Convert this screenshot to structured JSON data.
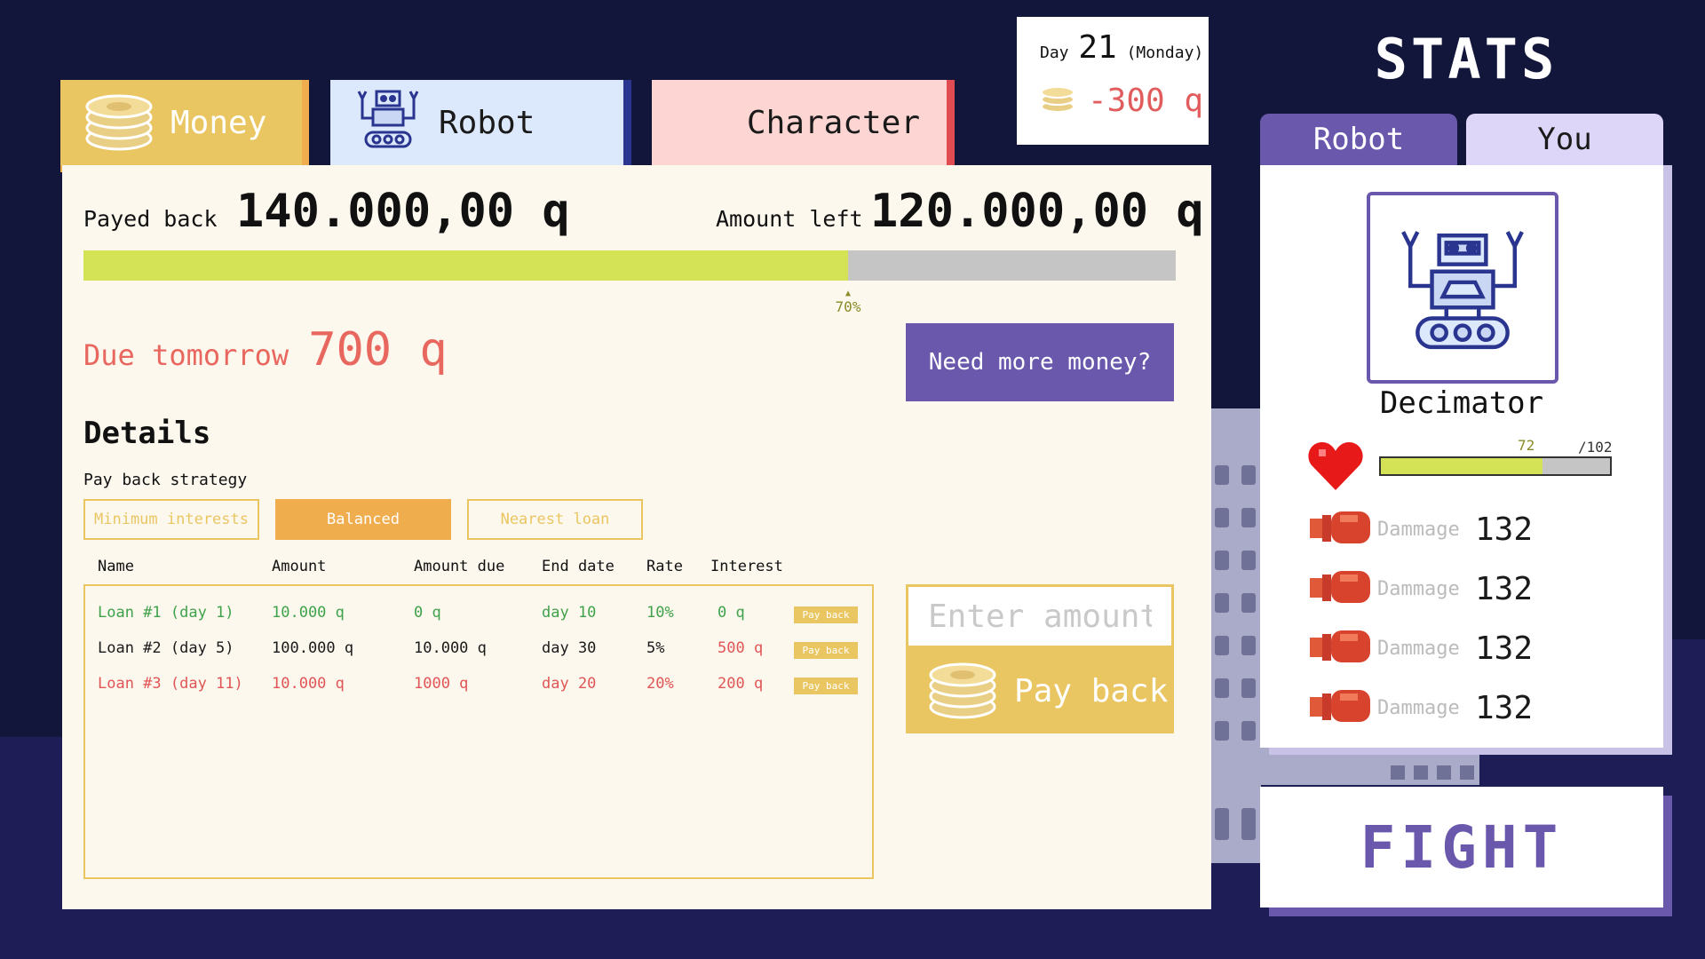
{
  "colors": {
    "background": "#13163b",
    "gold": "#eac662",
    "orange": "#f0ad4e",
    "purple": "#6a58ad",
    "progress_fill": "#d3e355",
    "green": "#3fa24a",
    "red": "#e05555"
  },
  "tabs": [
    {
      "label": "Money",
      "icon": "coins-icon"
    },
    {
      "label": "Robot",
      "icon": "robot-icon"
    },
    {
      "label": "Character"
    }
  ],
  "day": {
    "prefix": "Day",
    "number": "21",
    "weekday": "(Monday)",
    "balance": "-300 q",
    "balance_icon": "coins-icon"
  },
  "money": {
    "payed_back_label": "Payed back",
    "payed_back_value": "140.000,00 q",
    "amount_left_label": "Amount left",
    "amount_left_value": "120.000,00 q",
    "progress_percent": 70,
    "progress_label": "70%",
    "due_label": "Due tomorrow",
    "due_value": "700 q",
    "more_money_button": "Need more money?",
    "details_title": "Details",
    "strategy_label": "Pay back strategy",
    "strategies": [
      {
        "label": "Minimum interests",
        "active": false
      },
      {
        "label": "Balanced",
        "active": true
      },
      {
        "label": "Nearest loan",
        "active": false
      }
    ],
    "columns": [
      "Name",
      "Amount",
      "Amount due",
      "End date",
      "Rate",
      "Interest"
    ],
    "loans": [
      {
        "name": "Loan #1 (day 1)",
        "amount": "10.000 q",
        "amount_due": "0 q",
        "end_date": "day 10",
        "rate": "10%",
        "interest": "0 q",
        "status": "green",
        "action": "Pay back"
      },
      {
        "name": "Loan #2 (day 5)",
        "amount": "100.000 q",
        "amount_due": "10.000 q",
        "end_date": "day 30",
        "rate": "5%",
        "interest": "500 q",
        "status": "black",
        "action": "Pay back"
      },
      {
        "name": "Loan #3 (day 11)",
        "amount": "10.000 q",
        "amount_due": "1000 q",
        "end_date": "day 20",
        "rate": "20%",
        "interest": "200 q",
        "status": "red",
        "action": "Pay back"
      }
    ],
    "amount_input_placeholder": "Enter amount",
    "pay_back_button": "Pay back"
  },
  "stats": {
    "title": "STATS",
    "tabs": [
      {
        "label": "Robot",
        "active": true
      },
      {
        "label": "You",
        "active": false
      }
    ],
    "robot_name": "Decimator",
    "hp_current": "72",
    "hp_max": "/102",
    "hp_fraction": 0.706,
    "rows": [
      {
        "icon": "boxing-glove-icon",
        "label": "Dammage",
        "value": "132"
      },
      {
        "icon": "boxing-glove-icon",
        "label": "Dammage",
        "value": "132"
      },
      {
        "icon": "boxing-glove-icon",
        "label": "Dammage",
        "value": "132"
      },
      {
        "icon": "boxing-glove-icon",
        "label": "Dammage",
        "value": "132"
      }
    ],
    "fight_button": "FIGHT"
  }
}
